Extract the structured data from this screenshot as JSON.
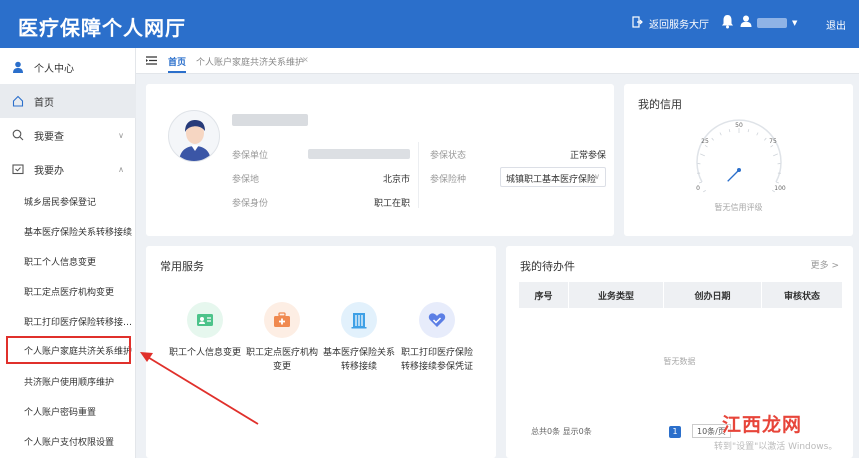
{
  "header": {
    "title": "医疗保障个人网厅",
    "back_label": "返回服务大厅",
    "logout_label": "退出"
  },
  "sidebar": {
    "items": [
      {
        "label": "个人中心",
        "icon": "user-icon"
      },
      {
        "label": "首页",
        "icon": "home-icon"
      },
      {
        "label": "我要查",
        "icon": "search-icon"
      },
      {
        "label": "我要办",
        "icon": "folder-icon"
      }
    ],
    "sub_items": [
      "城乡居民参保登记",
      "基本医疗保险关系转移接续",
      "职工个人信息变更",
      "职工定点医疗机构变更",
      "职工打印医疗保险转移接…",
      "个人账户家庭共济关系维护",
      "共济账户使用顺序维护",
      "个人账户密码重置",
      "个人账户支付权限设置"
    ]
  },
  "tabs": {
    "home": "首页",
    "current": "个人账户家庭共济关系维护",
    "close": "×"
  },
  "profile": {
    "fields": {
      "unit_label": "参保单位",
      "status_label": "参保状态",
      "status_value": "正常参保",
      "place_label": "参保地",
      "place_value": "北京市",
      "insurance_label": "参保险种",
      "insurance_value": "城镇职工基本医疗保险",
      "identity_label": "参保身份",
      "identity_value": "职工在职"
    }
  },
  "credit": {
    "title": "我的信用",
    "gauge_ticks": [
      "0",
      "25",
      "50",
      "75",
      "100"
    ],
    "gauge_value": 0,
    "note": "暂无信用评级"
  },
  "services": {
    "title": "常用服务",
    "items": [
      {
        "label_1": "职工个人信息变更",
        "label_2": "",
        "icon": "id-card-icon",
        "color": "#4cc38a",
        "bg": "#e6f7ee"
      },
      {
        "label_1": "职工定点医疗机构",
        "label_2": "变更",
        "icon": "medical-kit-icon",
        "color": "#f0894f",
        "bg": "#fdeee4"
      },
      {
        "label_1": "基本医疗保险关系",
        "label_2": "转移接续",
        "icon": "building-icon",
        "color": "#3ea0e6",
        "bg": "#e2f1fc"
      },
      {
        "label_1": "职工打印医疗保险",
        "label_2": "转移接续参保凭证",
        "icon": "heart-check-icon",
        "color": "#5b7ee5",
        "bg": "#e7ecfb"
      }
    ]
  },
  "todo": {
    "title": "我的待办件",
    "more": "更多 >",
    "columns": [
      "序号",
      "业务类型",
      "创办日期",
      "审核状态"
    ],
    "empty": "暂无数据",
    "pagination_text": "总共0条 显示0条",
    "current_page": "1",
    "page_size": "10条/页",
    "activate_windows": "转到\"设置\"以激活 Windows。"
  },
  "watermark": "江西龙网",
  "colors": {
    "brand": "#2b6fcb",
    "highlight": "#e0302b"
  }
}
